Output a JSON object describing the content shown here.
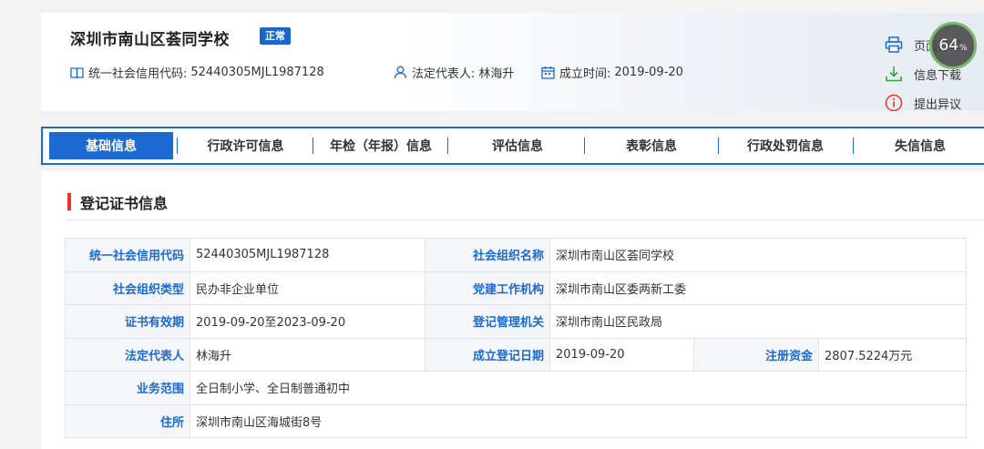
{
  "header": {
    "org_name": "深圳市南山区荟同学校",
    "status": "正常",
    "credit_code_label": "统一社会信用代码:",
    "credit_code": "52440305MJL1987128",
    "legal_rep_label": "法定代表人:",
    "legal_rep": "林海升",
    "founded_label": "成立时间:",
    "founded": "2019-09-20"
  },
  "actions": {
    "print": "页面打印",
    "download": "信息下载",
    "objection": "提出异议"
  },
  "zoom": {
    "value": "64",
    "unit": "%"
  },
  "tabs": [
    {
      "label": "基础信息",
      "active": true
    },
    {
      "label": "行政许可信息",
      "active": false
    },
    {
      "label": "年检（年报）信息",
      "active": false
    },
    {
      "label": "评估信息",
      "active": false
    },
    {
      "label": "表彰信息",
      "active": false
    },
    {
      "label": "行政处罚信息",
      "active": false
    },
    {
      "label": "失信信息",
      "active": false
    }
  ],
  "section": {
    "title": "登记证书信息"
  },
  "info": {
    "credit_code_k": "统一社会信用代码",
    "credit_code_v": "52440305MJL1987128",
    "org_name_k": "社会组织名称",
    "org_name_v": "深圳市南山区荟同学校",
    "org_type_k": "社会组织类型",
    "org_type_v": "民办非企业单位",
    "party_k": "党建工作机构",
    "party_v": "深圳市南山区委两新工委",
    "validity_k": "证书有效期",
    "validity_v": "2019-09-20至2023-09-20",
    "authority_k": "登记管理机关",
    "authority_v": "深圳市南山区民政局",
    "legal_k": "法定代表人",
    "legal_v": "林海升",
    "reg_date_k": "成立登记日期",
    "reg_date_v": "2019-09-20",
    "capital_k": "注册资金",
    "capital_v": "2807.5224万元",
    "scope_k": "业务范围",
    "scope_v": "全日制小学、全日制普通初中",
    "address_k": "住所",
    "address_v": "深圳市南山区海城街8号"
  },
  "colors": {
    "accent": "#1c6ad1",
    "section_marker": "#e8332f",
    "download_icon": "#3aa53a",
    "objection_icon": "#e8332f"
  }
}
